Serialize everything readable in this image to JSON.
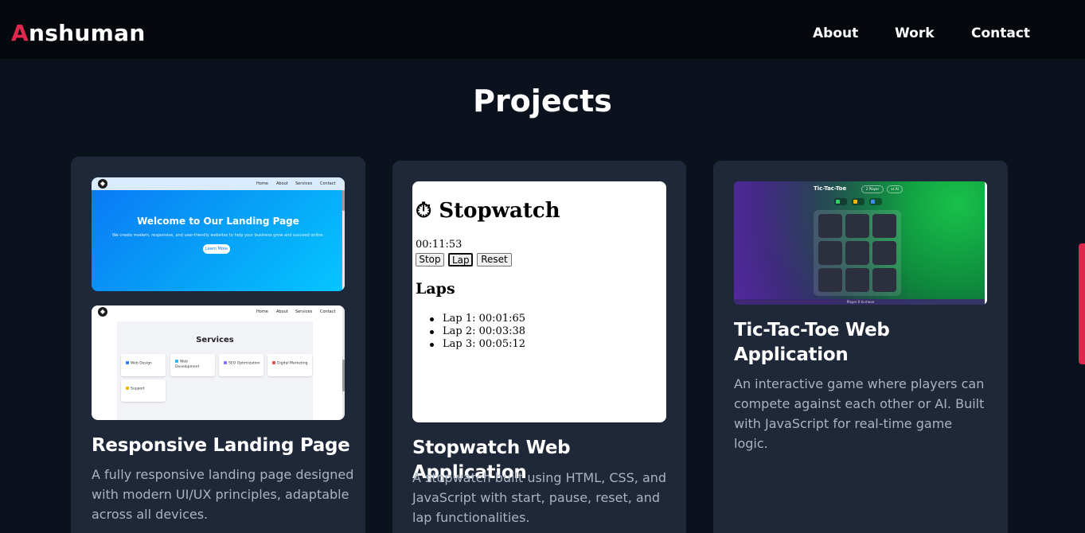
{
  "brand": {
    "first_letter": "A",
    "rest": "nshuman"
  },
  "nav": {
    "links": [
      "About",
      "Work",
      "Contact"
    ]
  },
  "section_title": "Projects",
  "colors": {
    "accent": "#e0274d",
    "background": "#0b111d",
    "card": "#1f2839"
  },
  "projects": [
    {
      "title": "Responsive Landing Page",
      "description": "A fully responsive landing page designed with modern UI/UX principles, adaptable across all devices.",
      "preview": {
        "nav_links": [
          "Home",
          "About",
          "Services",
          "Contact"
        ],
        "hero_title": "Welcome to Our Landing Page",
        "hero_subtitle": "We create modern, responsive, and user-friendly websites to help your business grow and succeed online.",
        "hero_button": "Learn More",
        "services_title": "Services",
        "services": [
          "Web Design",
          "Web Development",
          "SEO Optimization",
          "Digital Marketing",
          "Support"
        ]
      }
    },
    {
      "title": "Stopwatch Web Application",
      "description": "A stopwatch built using HTML, CSS, and JavaScript with start, pause, reset, and lap functionalities.",
      "preview": {
        "icon": "stopwatch-icon",
        "title": "Stopwatch",
        "time": "00:11:53",
        "buttons": [
          "Stop",
          "Lap",
          "Reset"
        ],
        "laps_heading": "Laps",
        "laps": [
          "Lap 1: 00:01:65",
          "Lap 2: 00:03:38",
          "Lap 3: 00:05:12"
        ]
      }
    },
    {
      "title": "Tic-Tac-Toe Web Application",
      "description": "An interactive game where players can compete against each other or AI. Built with JavaScript for real-time game logic.",
      "preview": {
        "title": "Tic-Tac-Toe",
        "pills": [
          "2 Player",
          "vs AI"
        ],
        "footer": "Player X to move"
      }
    }
  ]
}
